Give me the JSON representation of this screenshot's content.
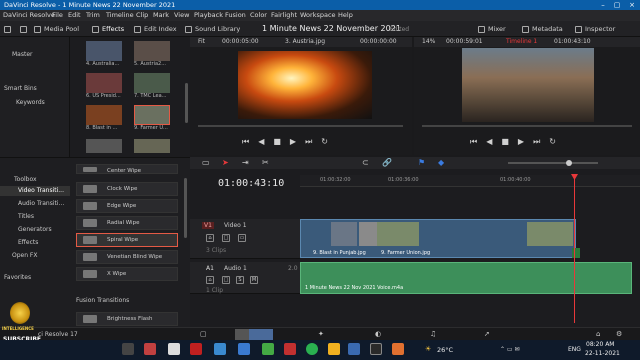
{
  "window": {
    "title": "DaVinci Resolve - 1 Minute News 22 November 2021"
  },
  "menu": [
    "DaVinci Resolve",
    "File",
    "Edit",
    "Trim",
    "Timeline",
    "Clip",
    "Mark",
    "View",
    "Playback",
    "Fusion",
    "Color",
    "Fairlight",
    "Workspace",
    "Help"
  ],
  "toolbar": {
    "media_pool": "Media Pool",
    "effects": "Effects",
    "edit_index": "Edit Index",
    "sound_library": "Sound Library",
    "project_title": "1 Minute News 22 November 2021",
    "project_status": "Edited",
    "mixer": "Mixer",
    "metadata": "Metadata",
    "inspector": "Inspector"
  },
  "source_viewer": {
    "fit": "Fit",
    "timecode_in": "00:00:05:00",
    "clip_name": "3. Austria.jpg",
    "timecode_pos": "00:00:00:00"
  },
  "timeline_viewer": {
    "zoom": "14%",
    "duration": "00:00:59:01",
    "timeline_name": "Timeline 1",
    "timecode": "01:00:43:10"
  },
  "bins": {
    "master": "Master",
    "smart_bins": "Smart Bins",
    "keywords": "Keywords"
  },
  "media_thumbs": [
    {
      "label": "4. Australia..."
    },
    {
      "label": "5. Austria2..."
    },
    {
      "label": "6. US Presid..."
    },
    {
      "label": "7. TMC Lea..."
    },
    {
      "label": "8. Blast in ..."
    },
    {
      "label": "9. Farmer U..."
    }
  ],
  "toolbox": {
    "toolbox": "Toolbox",
    "video_transitions": "Video Transiti...",
    "audio_transitions": "Audio Transiti...",
    "titles": "Titles",
    "generators": "Generators",
    "effects": "Effects",
    "open_fx": "Open FX",
    "favorites": "Favorites"
  },
  "fx_list": [
    "Center Wipe",
    "Clock Wipe",
    "Edge Wipe",
    "Radial Wipe",
    "Spiral Wipe",
    "Venetian Blind Wipe",
    "X Wipe"
  ],
  "fusion": {
    "header": "Fusion Transitions",
    "item": "Brightness Flash"
  },
  "timeline": {
    "timecode": "01:00:43:10",
    "ruler": [
      "01:00:32:00",
      "01:00:36:00",
      "01:00:40:00"
    ],
    "v1": {
      "badge": "V1",
      "name": "Video 1",
      "clips": "3 Clips"
    },
    "a1": {
      "badge": "A1",
      "name": "Audio 1",
      "level": "2.0",
      "clips": "1 Clip"
    },
    "video_clips": [
      "9. Blast in Punjab.jpg",
      "9. Farmer Union.jpg"
    ],
    "audio_clip": "1 Minute News 22 Nov 2021 Voice.m4a"
  },
  "brand": {
    "line1": "INTELLIGENCE",
    "line2": "SUBSCRIBE",
    "app": "ci Resolve 17"
  },
  "taskbar": {
    "temp": "26°C",
    "lang": "ENG",
    "time": "08:20 AM",
    "date": "22-11-2021"
  },
  "colors": {
    "accent_red": "#e8383a",
    "video_clip": "#3a5a7a",
    "audio_clip": "#3d8f5a",
    "title_bar": "#0b5ea8"
  }
}
